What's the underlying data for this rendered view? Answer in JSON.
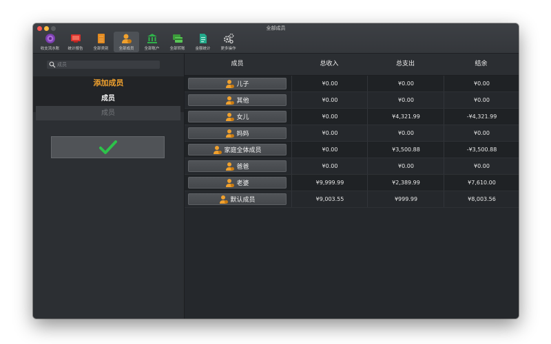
{
  "window": {
    "title": "全部成员"
  },
  "toolbar": {
    "items": [
      {
        "label": "收支流水账",
        "icon": "ledger-icon"
      },
      {
        "label": "统计报告",
        "icon": "report-icon"
      },
      {
        "label": "全部类别",
        "icon": "category-icon"
      },
      {
        "label": "全部成员",
        "icon": "members-icon",
        "active": true
      },
      {
        "label": "全部账户",
        "icon": "bank-icon"
      },
      {
        "label": "全部转账",
        "icon": "transfer-icon"
      },
      {
        "label": "金额统计",
        "icon": "amount-stats-icon"
      },
      {
        "label": "更多操作",
        "icon": "gears-icon"
      }
    ]
  },
  "sidebar": {
    "search_placeholder": "成员",
    "add_title": "添加成员",
    "field_label": "成员",
    "field_placeholder": "成员"
  },
  "table": {
    "headers": {
      "member": "成员",
      "income": "总收入",
      "expense": "总支出",
      "balance": "结余"
    },
    "rows": [
      {
        "name": "儿子",
        "income": "¥0.00",
        "expense": "¥0.00",
        "balance": "¥0.00"
      },
      {
        "name": "其他",
        "income": "¥0.00",
        "expense": "¥0.00",
        "balance": "¥0.00"
      },
      {
        "name": "女儿",
        "income": "¥0.00",
        "expense": "¥4,321.99",
        "balance": "-¥4,321.99"
      },
      {
        "name": "妈妈",
        "income": "¥0.00",
        "expense": "¥0.00",
        "balance": "¥0.00"
      },
      {
        "name": "家庭全体成员",
        "income": "¥0.00",
        "expense": "¥3,500.88",
        "balance": "-¥3,500.88"
      },
      {
        "name": "爸爸",
        "income": "¥0.00",
        "expense": "¥0.00",
        "balance": "¥0.00"
      },
      {
        "name": "老婆",
        "income": "¥9,999.99",
        "expense": "¥2,389.99",
        "balance": "¥7,610.00"
      },
      {
        "name": "默认成员",
        "income": "¥9,003.55",
        "expense": "¥999.99",
        "balance": "¥8,003.56"
      }
    ]
  },
  "colors": {
    "accent": "#f0a12e",
    "confirm": "#2dc24a",
    "window_bg": "#2a2d31"
  }
}
